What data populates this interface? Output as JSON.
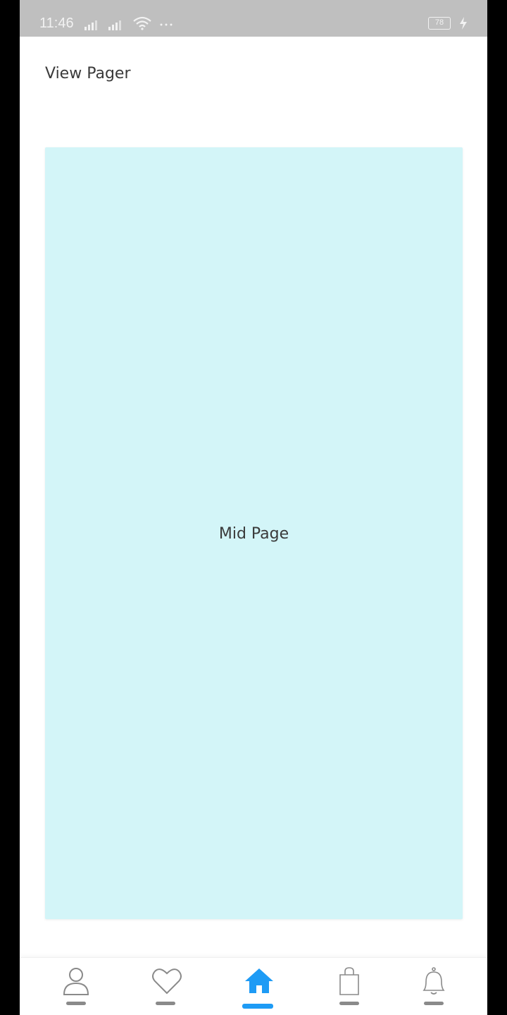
{
  "status_bar": {
    "time": "11:46",
    "battery": "78",
    "icons": [
      "signal-icon",
      "signal-icon",
      "wifi-icon",
      "more-dots-icon",
      "battery-icon",
      "charging-icon"
    ]
  },
  "header": {
    "title": "View Pager"
  },
  "pager": {
    "page_label": "Mid Page",
    "background_color": "#d3f5f8"
  },
  "bottom_nav": {
    "active_color": "#1e9bf5",
    "inactive_color": "#8a8a8a",
    "items": [
      {
        "icon": "user-icon",
        "active": false
      },
      {
        "icon": "heart-icon",
        "active": false
      },
      {
        "icon": "home-icon",
        "active": true
      },
      {
        "icon": "shopping-bag-icon",
        "active": false
      },
      {
        "icon": "bell-icon",
        "active": false
      }
    ]
  }
}
